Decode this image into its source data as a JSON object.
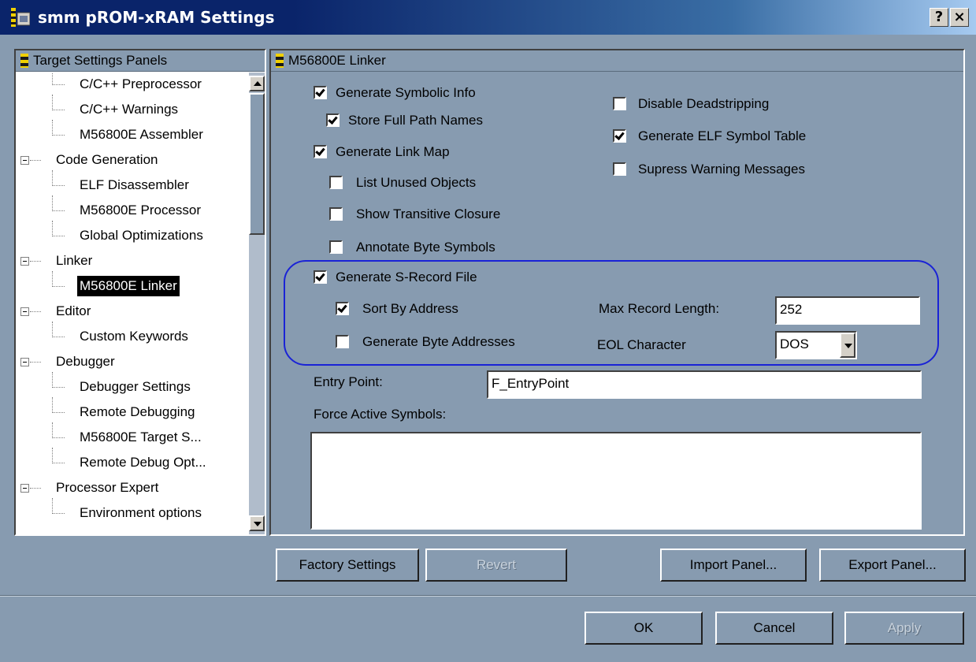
{
  "window": {
    "title": "smm pROM-xRAM Settings",
    "help_label": "?",
    "close_label": "×"
  },
  "tree": {
    "header": "Target Settings Panels",
    "items": [
      {
        "label": "C/C++ Preprocessor",
        "level": 1
      },
      {
        "label": "C/C++ Warnings",
        "level": 1
      },
      {
        "label": "M56800E Assembler",
        "level": 1
      },
      {
        "label": "Code Generation",
        "level": 0
      },
      {
        "label": "ELF Disassembler",
        "level": 1
      },
      {
        "label": "M56800E Processor",
        "level": 1
      },
      {
        "label": "Global Optimizations",
        "level": 1
      },
      {
        "label": "Linker",
        "level": 0
      },
      {
        "label": "M56800E Linker",
        "level": 1,
        "selected": true
      },
      {
        "label": "Editor",
        "level": 0
      },
      {
        "label": "Custom Keywords",
        "level": 1
      },
      {
        "label": "Debugger",
        "level": 0
      },
      {
        "label": "Debugger Settings",
        "level": 1
      },
      {
        "label": "Remote Debugging",
        "level": 1
      },
      {
        "label": "M56800E Target S...",
        "level": 1
      },
      {
        "label": "Remote Debug Opt...",
        "level": 1
      },
      {
        "label": "Processor Expert",
        "level": 0
      },
      {
        "label": "Environment options",
        "level": 1
      }
    ]
  },
  "panel": {
    "header": "M56800E Linker",
    "checkboxes": {
      "generate_symbolic_info": {
        "label": "Generate Symbolic Info",
        "checked": true
      },
      "store_full_path_names": {
        "label": "Store Full Path Names",
        "checked": true
      },
      "generate_link_map": {
        "label": "Generate Link Map",
        "checked": true
      },
      "list_unused_objects": {
        "label": "List Unused Objects",
        "checked": false
      },
      "show_transitive_closure": {
        "label": "Show Transitive Closure",
        "checked": false
      },
      "annotate_byte_symbols": {
        "label": "Annotate Byte Symbols",
        "checked": false
      },
      "disable_deadstripping": {
        "label": "Disable Deadstripping",
        "checked": false
      },
      "generate_elf_symbol_table": {
        "label": "Generate ELF Symbol Table",
        "checked": true
      },
      "supress_warning_messages": {
        "label": "Supress Warning Messages",
        "checked": false
      },
      "generate_s_record_file": {
        "label": "Generate S-Record File",
        "checked": true
      },
      "sort_by_address": {
        "label": "Sort By Address",
        "checked": true
      },
      "generate_byte_addresses": {
        "label": "Generate Byte Addresses",
        "checked": false
      }
    },
    "max_record_length": {
      "label": "Max Record Length:",
      "value": "252"
    },
    "eol_character": {
      "label": "EOL Character",
      "value": "DOS"
    },
    "entry_point": {
      "label": "Entry Point:",
      "value": "F_EntryPoint"
    },
    "force_active_symbols": {
      "label": "Force Active Symbols:",
      "value": ""
    }
  },
  "buttons": {
    "factory_settings": "Factory Settings",
    "revert": "Revert",
    "import_panel": "Import Panel...",
    "export_panel": "Export Panel...",
    "ok": "OK",
    "cancel": "Cancel",
    "apply": "Apply"
  },
  "colors": {
    "dialog_bg": "#879bb0",
    "title_bar": "#0a246a",
    "highlight_ring": "#1a23d6"
  }
}
